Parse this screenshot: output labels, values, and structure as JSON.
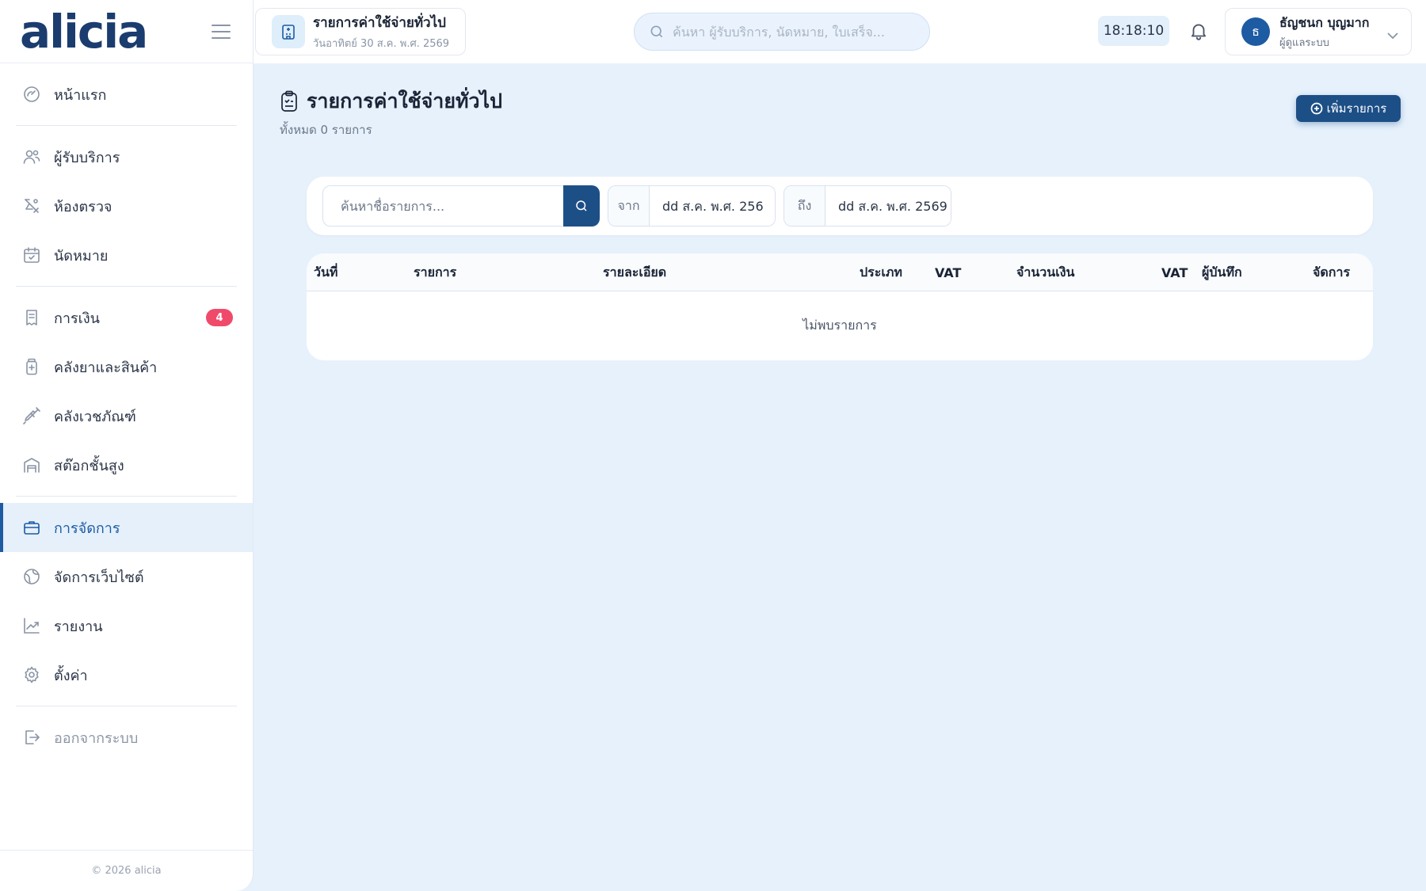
{
  "brand": {
    "logo": "alicia"
  },
  "sidebar": {
    "items": [
      {
        "label": "หน้าแรก",
        "icon": "dashboard-icon"
      },
      {
        "label": "ผู้รับบริการ",
        "icon": "users-icon"
      },
      {
        "label": "ห้องตรวจ",
        "icon": "stethoscope-icon"
      },
      {
        "label": "นัดหมาย",
        "icon": "calendar-check-icon"
      },
      {
        "label": "การเงิน",
        "icon": "receipt-icon",
        "badge": "4"
      },
      {
        "label": "คลังยาและสินค้า",
        "icon": "medicine-bottle-icon"
      },
      {
        "label": "คลังเวชภัณฑ์",
        "icon": "syringe-icon"
      },
      {
        "label": "สต๊อกชั้นสูง",
        "icon": "warehouse-icon"
      },
      {
        "label": "การจัดการ",
        "icon": "briefcase-icon",
        "active": true
      },
      {
        "label": "จัดการเว็บไซต์",
        "icon": "globe-icon"
      },
      {
        "label": "รายงาน",
        "icon": "chart-line-icon"
      },
      {
        "label": "ตั้งค่า",
        "icon": "gear-icon"
      },
      {
        "label": "ออกจากระบบ",
        "icon": "logout-icon"
      }
    ],
    "footer": "© 2026 alicia"
  },
  "topbar": {
    "tab": {
      "title": "รายการค่าใช้จ่ายทั่วไป",
      "subtitle": "วันอาทิตย์ 30 ส.ค. พ.ศ. 2569"
    },
    "search_placeholder": "ค้นหา ผู้รับบริการ, นัดหมาย, ใบเสร็จ...",
    "clock": "18:18:10",
    "user": {
      "initial": "ธ",
      "name": "ธัญชนก บุญมาก",
      "role": "ผู้ดูแลระบบ"
    }
  },
  "page": {
    "title": "รายการค่าใช้จ่ายทั่วไป",
    "subtitle": "ทั้งหมด 0 รายการ",
    "add_button": "เพิ่มรายการ"
  },
  "filters": {
    "search_placeholder": "ค้นหาชื่อรายการ...",
    "from_label": "จาก",
    "from_value": "dd ส.ค. พ.ศ. 256",
    "to_label": "ถึง",
    "to_value": "dd ส.ค. พ.ศ. 2569"
  },
  "table": {
    "headers": [
      "วันที่",
      "รายการ",
      "รายละเอียด",
      "ประเภท",
      "VAT",
      "จำนวนเงิน",
      "VAT",
      "ผู้บันทึก",
      "จัดการ"
    ],
    "empty_text": "ไม่พบรายการ"
  },
  "colors": {
    "primary": "#1d4f87",
    "accent": "#1d5ba3",
    "badge": "#f04a6a",
    "background": "#e6f1fc"
  }
}
